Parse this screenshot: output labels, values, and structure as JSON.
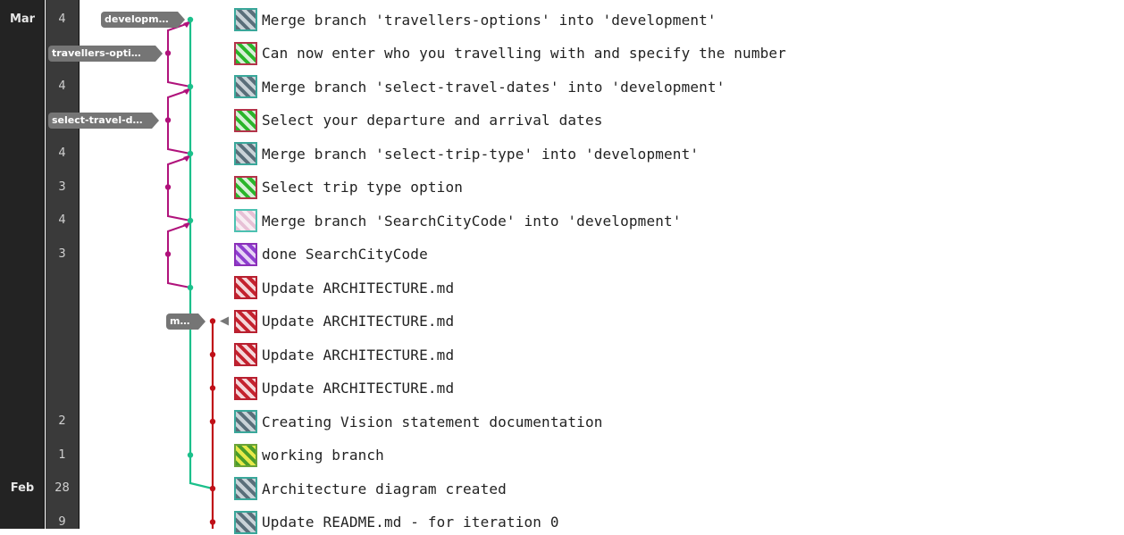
{
  "months": [
    {
      "label": "Mar",
      "row": 0
    },
    {
      "label": "Feb",
      "row": 14
    }
  ],
  "branch_tags": [
    {
      "name": "development",
      "row": 0
    },
    {
      "name": "travellers-opti…",
      "row": 1
    },
    {
      "name": "select-travel-d…",
      "row": 3
    },
    {
      "name": "main",
      "row": 9
    }
  ],
  "colors": {
    "development": "#1bc08b",
    "feature": "#b0127b",
    "main": "#c01018",
    "tag": "#757575"
  },
  "commits": [
    {
      "day": "4",
      "message": "Merge branch 'travellers-options' into 'development'",
      "avatar": "teal-gray"
    },
    {
      "day": "",
      "message": "Can now enter who you travelling with and specify the number",
      "avatar": "green-red"
    },
    {
      "day": "4",
      "message": "Merge branch 'select-travel-dates' into 'development'",
      "avatar": "teal-gray"
    },
    {
      "day": "",
      "message": "Select your departure and arrival dates",
      "avatar": "green-red"
    },
    {
      "day": "4",
      "message": "Merge branch 'select-trip-type' into 'development'",
      "avatar": "teal-gray"
    },
    {
      "day": "3",
      "message": "Select trip type option",
      "avatar": "green-red"
    },
    {
      "day": "4",
      "message": "Merge branch 'SearchCityCode' into 'development'",
      "avatar": "pink-teal"
    },
    {
      "day": "3",
      "message": "done SearchCityCode",
      "avatar": "purple"
    },
    {
      "day": "",
      "message": "Update ARCHITECTURE.md",
      "avatar": "red-white"
    },
    {
      "day": "",
      "message": "Update ARCHITECTURE.md",
      "avatar": "red-white"
    },
    {
      "day": "",
      "message": "Update ARCHITECTURE.md",
      "avatar": "red-white"
    },
    {
      "day": "",
      "message": "Update ARCHITECTURE.md",
      "avatar": "red-white"
    },
    {
      "day": "2",
      "message": "Creating Vision statement documentation",
      "avatar": "teal-gray"
    },
    {
      "day": "1",
      "message": "working branch",
      "avatar": "green-yellow"
    },
    {
      "day": "28",
      "message": "Architecture diagram created",
      "avatar": "teal-gray"
    },
    {
      "day": "9",
      "message": "Update README.md - for iteration 0",
      "avatar": "teal-gray"
    }
  ]
}
